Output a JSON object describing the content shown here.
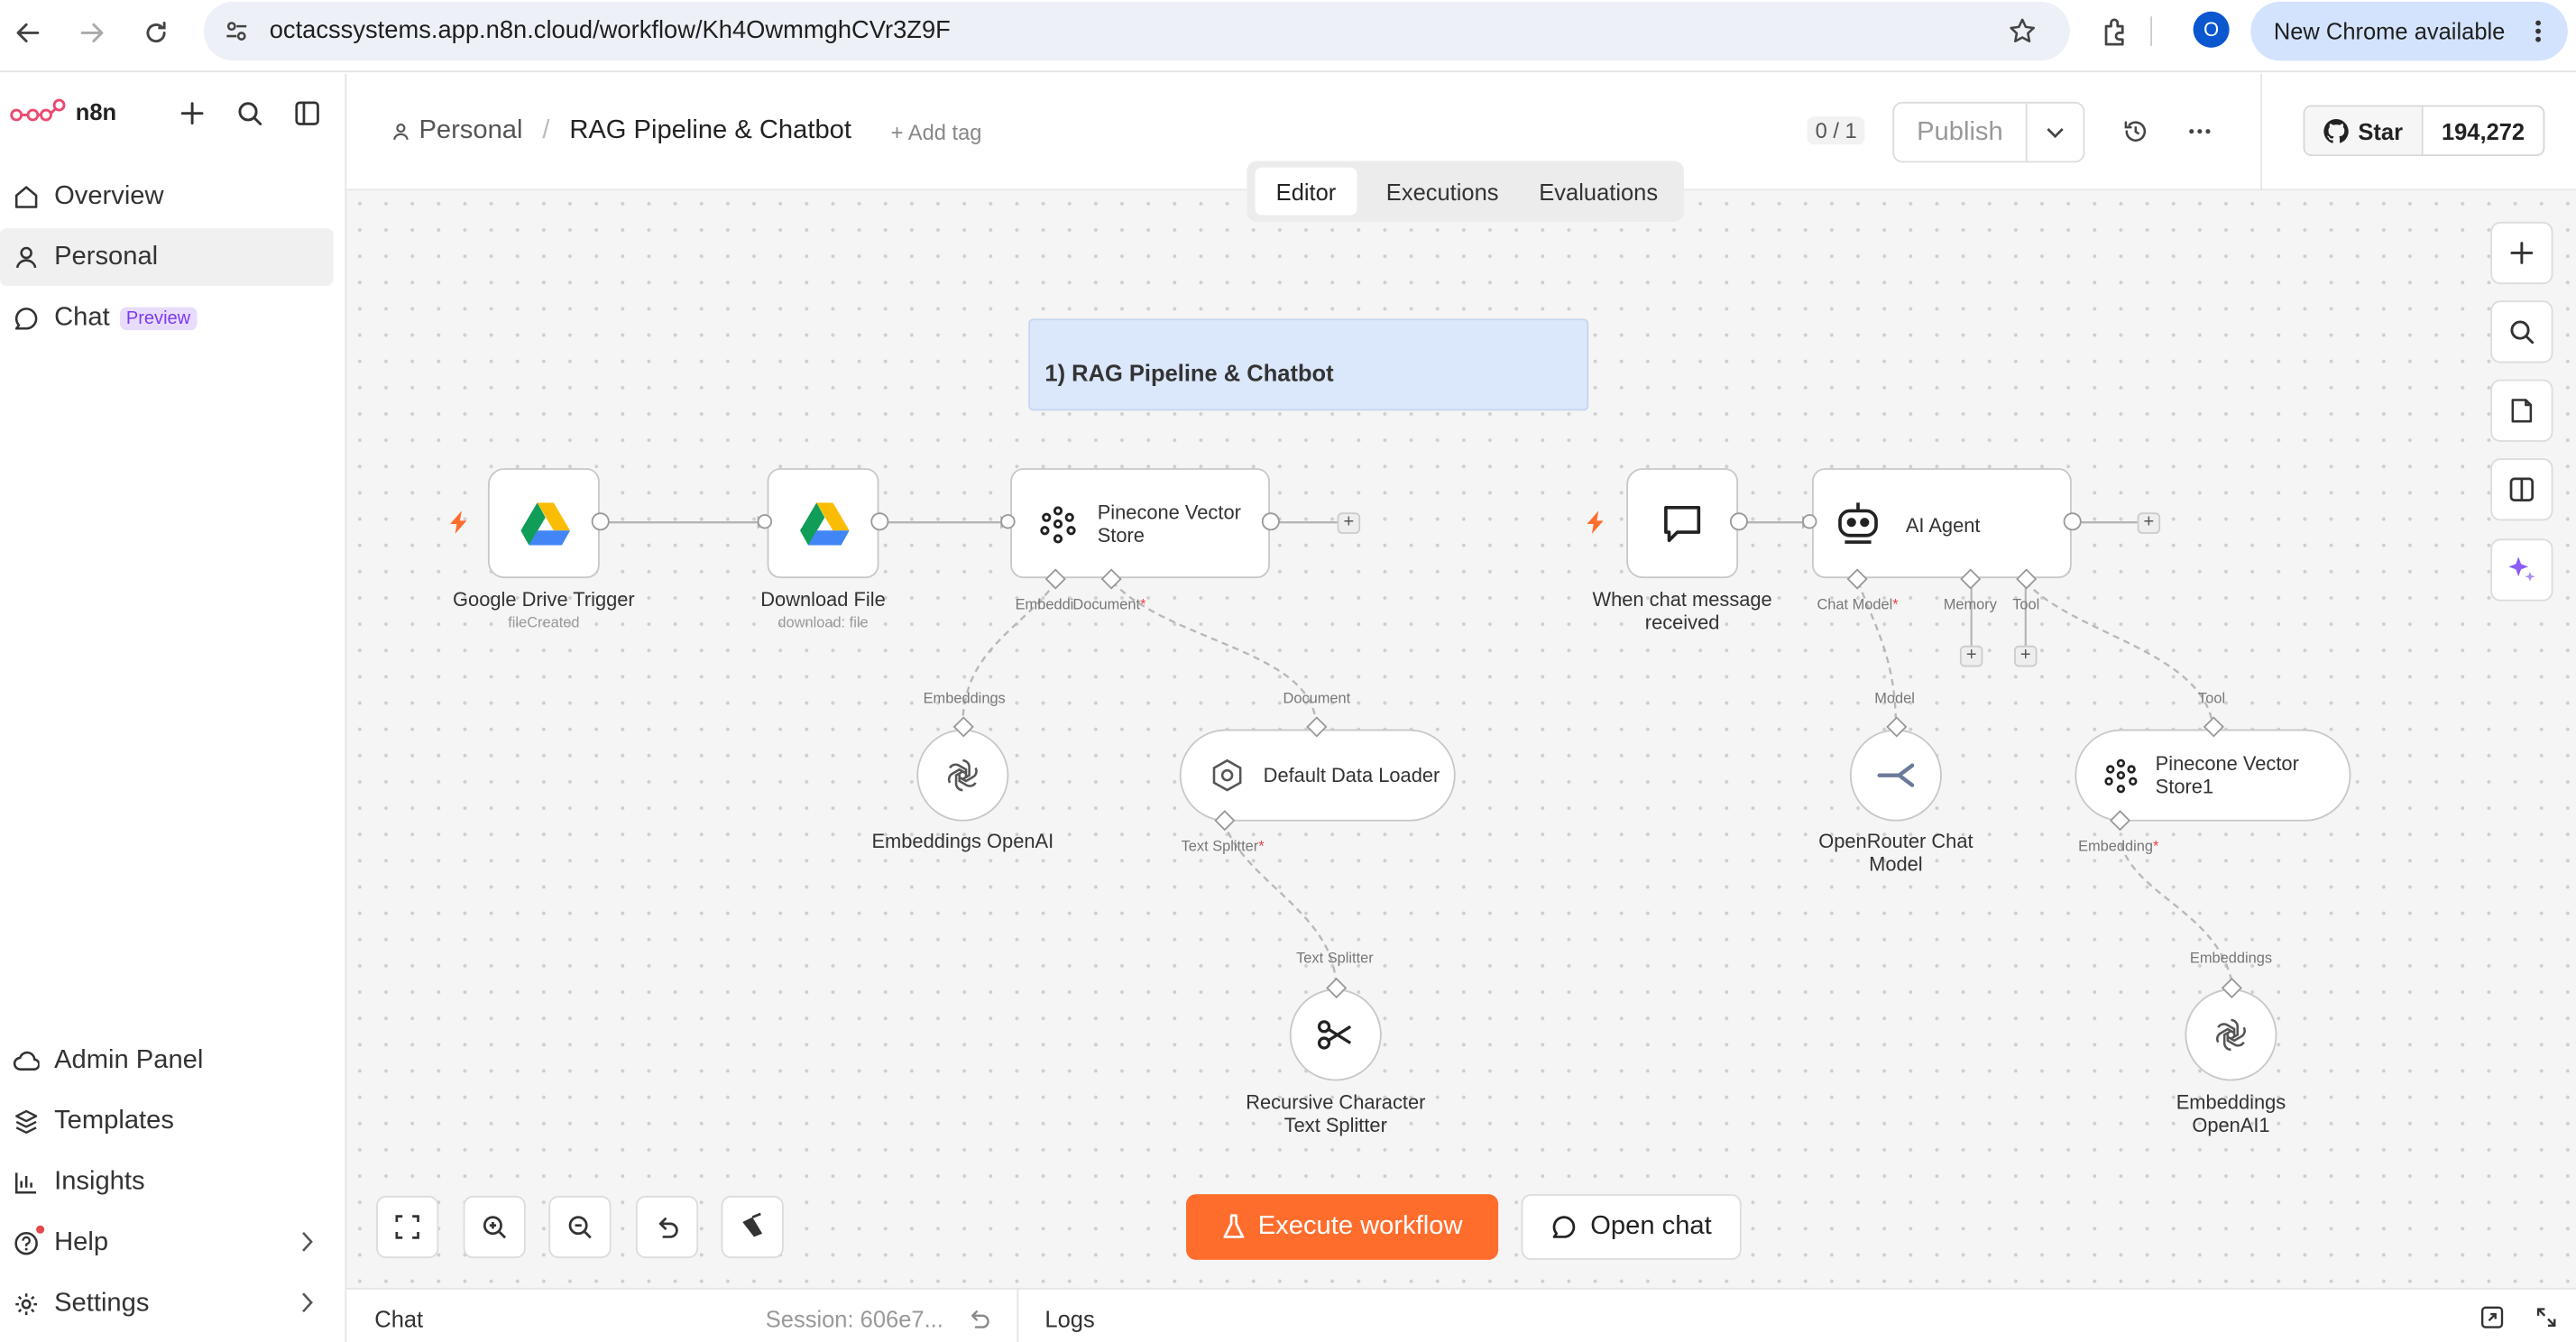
{
  "browser": {
    "url": "octacssystems.app.n8n.cloud/workflow/Kh4OwmmghCVr3Z9F",
    "profile_initial": "O",
    "update_label": "New Chrome available"
  },
  "sidebar": {
    "brand": "n8n",
    "items": [
      {
        "label": "Overview"
      },
      {
        "label": "Personal"
      },
      {
        "label": "Chat",
        "badge": "Preview"
      }
    ],
    "bottom_items": [
      {
        "label": "Admin Panel"
      },
      {
        "label": "Templates"
      },
      {
        "label": "Insights"
      },
      {
        "label": "Help"
      },
      {
        "label": "Settings"
      }
    ]
  },
  "header": {
    "breadcrumb_project": "Personal",
    "breadcrumb_sep": "/",
    "workflow_name": "RAG Pipeline & Chatbot",
    "add_tag": "+ Add tag",
    "version_count": "0 / 1",
    "publish_label": "Publish",
    "star_label": "Star",
    "star_count": "194,272",
    "tabs": [
      {
        "label": "Editor"
      },
      {
        "label": "Executions"
      },
      {
        "label": "Evaluations"
      }
    ]
  },
  "canvas": {
    "sticky_note": "1) RAG Pipeline & Chatbot",
    "nodes": {
      "gdrive_trigger": {
        "title": "Google Drive Trigger",
        "sub": "fileCreated"
      },
      "download_file": {
        "title": "Download File",
        "sub": "download: file"
      },
      "pinecone": {
        "title_line1": "Pinecone Vector",
        "title_line2": "Store"
      },
      "chat_trigger": {
        "title_line1": "When chat message",
        "title_line2": "received"
      },
      "ai_agent": {
        "title": "AI Agent"
      },
      "embeddings_openai": {
        "title": "Embeddings OpenAI"
      },
      "default_loader": {
        "title": "Default Data Loader"
      },
      "openrouter": {
        "title_line1": "OpenRouter Chat",
        "title_line2": "Model"
      },
      "pinecone1": {
        "title_line1": "Pinecone Vector",
        "title_line2": "Store1"
      },
      "splitter": {
        "title_line1": "Recursive Character",
        "title_line2": "Text Splitter"
      },
      "embeddings_openai1": {
        "title_line1": "Embeddings",
        "title_line2": "OpenAI1"
      }
    },
    "labels": {
      "embeddi": "Embeddi",
      "document": "Document",
      "embeddings": "Embeddings",
      "document2": "Document",
      "text_splitter": "Text Splitter",
      "text_splitter2": "Text Splitter",
      "chat_model": "Chat Model",
      "memory": "Memory",
      "tool": "Tool",
      "model": "Model",
      "tool2": "Tool",
      "embedding": "Embedding",
      "embeddings2": "Embeddings",
      "required": "*"
    },
    "execute_label": "Execute workflow",
    "open_chat_label": "Open chat"
  },
  "bottom": {
    "chat_label": "Chat",
    "session_label": "Session: 606e7...",
    "logs_label": "Logs"
  },
  "colors": {
    "brand": "#ea4b71",
    "execute": "#ff6d2d",
    "sticky_bg": "#dbe7fb",
    "preview_badge": "#e8dcfc"
  }
}
